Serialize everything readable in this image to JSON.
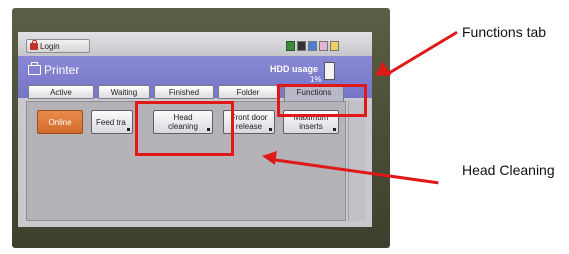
{
  "screen": {
    "login_label": "Login",
    "app_title": "Printer",
    "hdd_usage_label": "HDD usage",
    "hdd_usage_value": "1%",
    "status_icons": [
      "refresh-icon",
      "toner-icon",
      "cyan-icon",
      "magenta-icon",
      "yellow-icon"
    ]
  },
  "tabs": [
    {
      "label": "Active",
      "active": false
    },
    {
      "label": "Waiting",
      "active": false
    },
    {
      "label": "Finished",
      "active": false
    },
    {
      "label": "Folder",
      "active": false
    },
    {
      "label": "Functions",
      "active": true
    }
  ],
  "function_buttons": [
    {
      "label": "Online",
      "selected": true
    },
    {
      "label": "Feed tra",
      "selected": false
    },
    {
      "label": "Head\ncleaning",
      "selected": false
    },
    {
      "label": "Front door\nrelease",
      "selected": false
    },
    {
      "label": "Maximum\ninserts",
      "selected": false
    }
  ],
  "annotations": {
    "functions_tab": "Functions tab",
    "head_cleaning": "Head Cleaning"
  },
  "colors": {
    "header": "#7675c7",
    "online_button": "#d46c2c",
    "annotation_red": "#e01818"
  }
}
